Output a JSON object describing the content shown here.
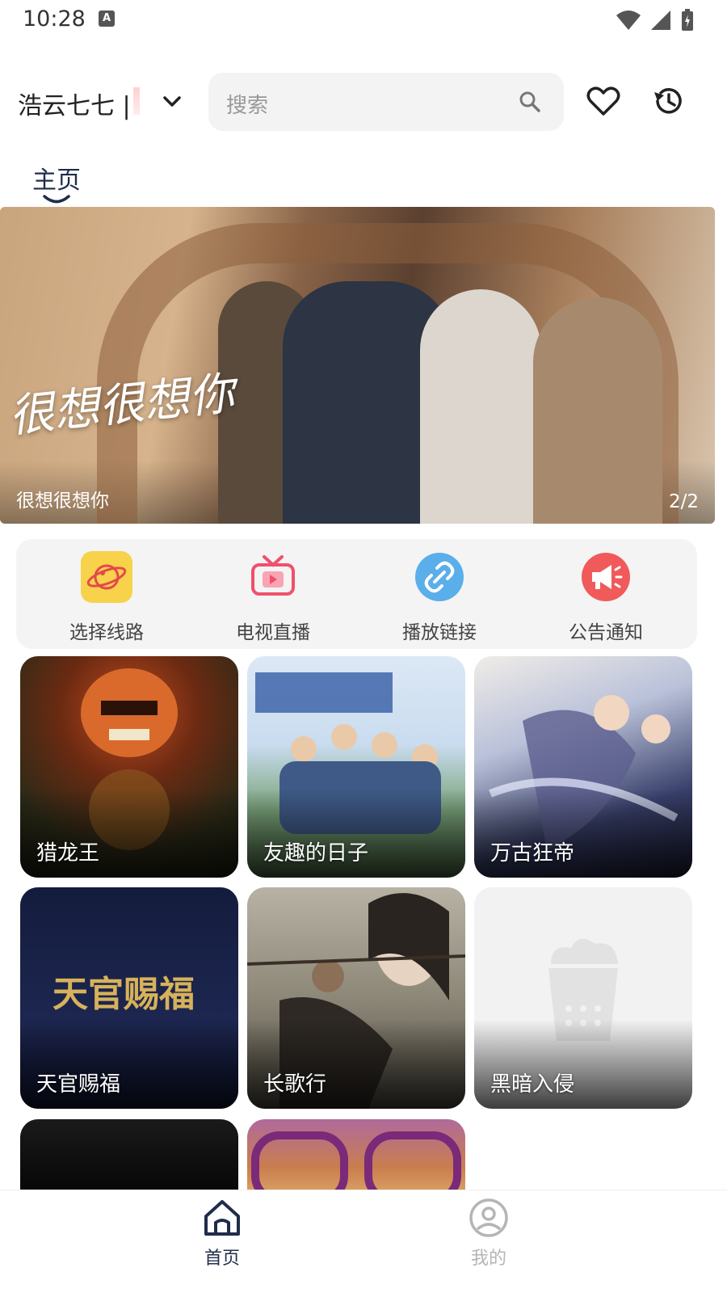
{
  "status_bar": {
    "time": "10:28",
    "notif_icon": "A"
  },
  "header": {
    "source_name": "浩云七七 |",
    "search_placeholder": "搜索"
  },
  "tabs": [
    {
      "label": "主页",
      "active": true
    }
  ],
  "banner": {
    "artwork_title": "很想很想你",
    "caption": "很想很想你",
    "counter": "2/2"
  },
  "quick_actions": [
    {
      "label": "选择线路",
      "icon": "planet-icon",
      "color": "#f7d24a"
    },
    {
      "label": "电视直播",
      "icon": "tv-icon",
      "color": "#f0506e"
    },
    {
      "label": "播放链接",
      "icon": "link-icon",
      "color": "#5aaeea"
    },
    {
      "label": "公告通知",
      "icon": "megaphone-icon",
      "color": "#f05a5a"
    }
  ],
  "cards": [
    {
      "title": "猎龙王"
    },
    {
      "title": "友趣的日子"
    },
    {
      "title": "万古狂帝"
    },
    {
      "title": "天官赐福",
      "poster_text": "天官赐福"
    },
    {
      "title": "长歌行"
    },
    {
      "title": "黑暗入侵"
    }
  ],
  "bottom_nav": [
    {
      "label": "首页",
      "active": true
    },
    {
      "label": "我的",
      "active": false
    }
  ],
  "colors": {
    "accent": "#1f2d4a",
    "inactive": "#b5b5b5"
  }
}
